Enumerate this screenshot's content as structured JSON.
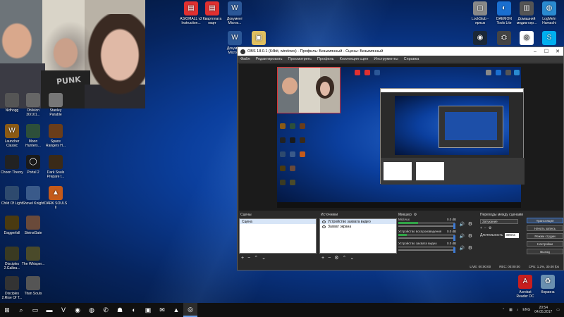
{
  "desktop": {
    "webcam_text": "PUNK",
    "icons_left": [
      {
        "label": "Nidhogg",
        "icon": "nidhogg-icon",
        "color": "#555"
      },
      {
        "label": "Oblivion 30/101...",
        "icon": "oblivion-icon",
        "color": "#666"
      },
      {
        "label": "Stanley Parable",
        "icon": "stanley-icon",
        "color": "#777"
      },
      {
        "label": "Launcher Classic",
        "icon": "wow-icon",
        "color": "#8b5a14"
      },
      {
        "label": "Moon Hunters...",
        "icon": "moon-hunters-icon",
        "color": "#2d4f3a"
      },
      {
        "label": "Space Rangers H...",
        "icon": "space-rangers-icon",
        "color": "#6a3d1a"
      },
      {
        "label": "Choon Theory",
        "icon": "choon-icon",
        "color": "#222"
      },
      {
        "label": "Portal 2",
        "icon": "portal-icon",
        "color": "#1a1a1a"
      },
      {
        "label": "Dark Souls Prepare t...",
        "icon": "dark-souls-icon",
        "color": "#3a2a18"
      },
      {
        "label": "Child Of Light",
        "icon": "child-of-light-icon",
        "color": "#2e4a6e"
      },
      {
        "label": "Shovel Knight",
        "icon": "shovel-knight-icon",
        "color": "#3a5a8a"
      },
      {
        "label": "DARK SOULS II",
        "icon": "dark-souls-2-icon",
        "color": "#c45a1a"
      },
      {
        "label": "Daggerfall",
        "icon": "daggerfall-icon",
        "color": "#4a3a10"
      },
      {
        "label": "SteinsGate",
        "icon": "steins-gate-icon",
        "color": "#6a4a3a"
      },
      {
        "label": "Disciples 2.Gallea...",
        "icon": "disciples-icon",
        "color": "#3a3a22"
      },
      {
        "label": "The Whisper...",
        "icon": "whisper-icon",
        "color": "#4a4a2a"
      },
      {
        "label": "Disciples 2.Rise Of T...",
        "icon": "disciples-rise-icon",
        "color": "#333"
      },
      {
        "label": "Titan Souls",
        "icon": "titan-souls-icon",
        "color": "#555"
      }
    ],
    "icons_top": [
      {
        "label": "ASIOMALL v2 Instruction...",
        "icon": "pdf-icon",
        "color": "#e03030"
      },
      {
        "label": "Квартплата март",
        "icon": "pdf-icon",
        "color": "#e03030"
      },
      {
        "label": "Документ Micros...",
        "icon": "word-icon",
        "color": "#2b5797"
      },
      {
        "label": "Документ Micros...",
        "icon": "word-icon",
        "color": "#2b5797"
      },
      {
        "label": "",
        "icon": "file-icon",
        "color": "#e0c060"
      }
    ],
    "icons_right": [
      {
        "label": "LockStub - ярлык",
        "icon": "lockstub-icon",
        "color": "#888"
      },
      {
        "label": "DAEMON Tools Lite",
        "icon": "daemon-icon",
        "color": "#1a6fd0"
      },
      {
        "label": "Домашний медиа-сер...",
        "icon": "media-server-icon",
        "color": "#555"
      },
      {
        "label": "LogMeIn Hamachi",
        "icon": "hamachi-icon",
        "color": "#2a8ad0"
      },
      {
        "label": "",
        "icon": "steam-icon",
        "color": "#1b2838"
      },
      {
        "label": "",
        "icon": "network-icon",
        "color": "#444"
      },
      {
        "label": "",
        "icon": "ubisoft-icon",
        "color": "#fff"
      },
      {
        "label": "",
        "icon": "skype-icon",
        "color": "#00aff0"
      }
    ],
    "icons_bottom_right": [
      {
        "label": "Acrobat Reader DC",
        "icon": "acrobat-icon",
        "color": "#c81e1e"
      },
      {
        "label": "Корзина",
        "icon": "recycle-bin-icon",
        "color": "#6a8fb0"
      }
    ]
  },
  "obs": {
    "title": "OBS 18.0.1 (64bit, windows) - Профиль: Безымянный - Сцены: Безымянный",
    "menu": [
      "Файл",
      "Редактировать",
      "Просмотреть",
      "Профиль",
      "Коллекция сцен",
      "Инструменты",
      "Справка"
    ],
    "scenes_header": "Сцены",
    "scenes": [
      "Сцена"
    ],
    "sources_header": "Источники",
    "sources": [
      "Устройство захвата видео",
      "Захват экрана"
    ],
    "mixer_header": "Микшер",
    "mixer_tracks": [
      {
        "name": "Мic/Aux",
        "db": "0.0 dB",
        "level": 0.35
      },
      {
        "name": "Устройство воспроизведения",
        "db": "0.0 dB",
        "level": 0.15
      },
      {
        "name": "Устройство захвата видео",
        "db": "0.0 dB",
        "level": 0.0
      }
    ],
    "transitions_header": "Переходы между сценами",
    "transition_selected": "Затухание",
    "duration_label": "Длительность",
    "duration_value": "300ms",
    "controls": [
      "Трансляция",
      "Начать запись",
      "Режим студии",
      "Настройки",
      "Выход"
    ],
    "status": {
      "live": "LIVE: 00:00:00",
      "rec": "REC: 00:00:00",
      "cpu": "CPU: 1.2%, 30.00 fps"
    }
  },
  "taskbar": {
    "items": [
      "start-icon",
      "search-icon",
      "task-view-icon",
      "file-explorer-icon",
      "vivaldi-icon",
      "chrome-icon",
      "firefox-icon",
      "whatsapp-icon",
      "ghost-icon",
      "daemon-icon",
      "remote-icon",
      "mail-icon",
      "pdf-icon",
      "obs-icon"
    ],
    "lang": "ENG",
    "time": "20:54",
    "date": "04.05.2017"
  }
}
